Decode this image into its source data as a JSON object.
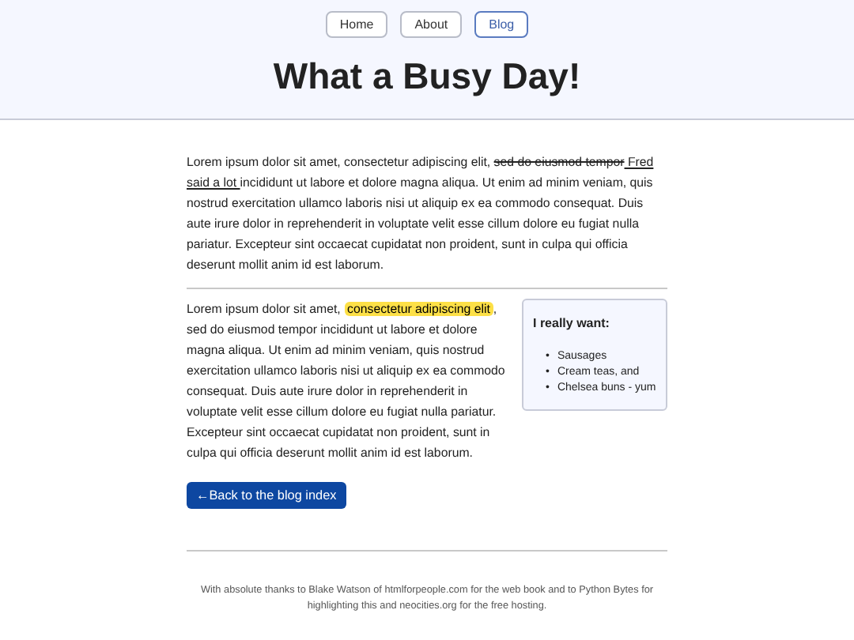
{
  "nav": [
    {
      "label": "Home",
      "selected": false
    },
    {
      "label": "About",
      "selected": false
    },
    {
      "label": "Blog",
      "selected": true
    }
  ],
  "title": "What a Busy Day!",
  "intro": [
    {
      "kind": "plain",
      "text": "Lorem ipsum dolor sit amet, consectetur adipiscing elit, "
    },
    {
      "kind": "strike",
      "text": "sed do eiusmod tempor"
    },
    {
      "kind": "underline",
      "text": " Fred said a lot "
    },
    {
      "kind": "plain",
      "text": "incididunt ut labore et dolore magna aliqua. Ut enim ad minim veniam, quis nostrud exercitation ullamco laboris nisi ut aliquip ex ea commodo consequat. Duis aute irure dolor in reprehenderit in voluptate velit esse cillum dolore eu fugiat nulla pariatur. Excepteur sint occaecat cupidatat non proident, sunt in culpa qui officia deserunt mollit anim id est laborum."
    }
  ],
  "body": [
    {
      "kind": "plain",
      "text": "Lorem ipsum dolor sit amet, "
    },
    {
      "kind": "highlight",
      "text": "consectetur adipiscing elit"
    },
    {
      "kind": "plain",
      "text": ", sed do eiusmod tempor incididunt ut labore et dolore magna aliqua. Ut enim ad minim veniam, quis nostrud exercitation ullamco laboris nisi ut aliquip ex ea commodo consequat. Duis aute irure dolor in reprehenderit in voluptate velit esse cillum dolore eu fugiat nulla pariatur. Excepteur sint occaecat cupidatat non proident, sunt in culpa qui officia deserunt mollit anim id est laborum."
    }
  ],
  "aside": {
    "title": "I really want:",
    "items": [
      {
        "bullet": "•",
        "text": "Sausages"
      },
      {
        "bullet": "•",
        "text": "Cream teas, and"
      },
      {
        "bullet": "•",
        "text": "Chelsea buns - yum"
      }
    ]
  },
  "back_button": "←Back to the blog index",
  "footer": "With absolute thanks to Blake Watson of htmlforpeople.com for the web book and to Python Bytes for highlighting this and neocities.org for the free hosting."
}
